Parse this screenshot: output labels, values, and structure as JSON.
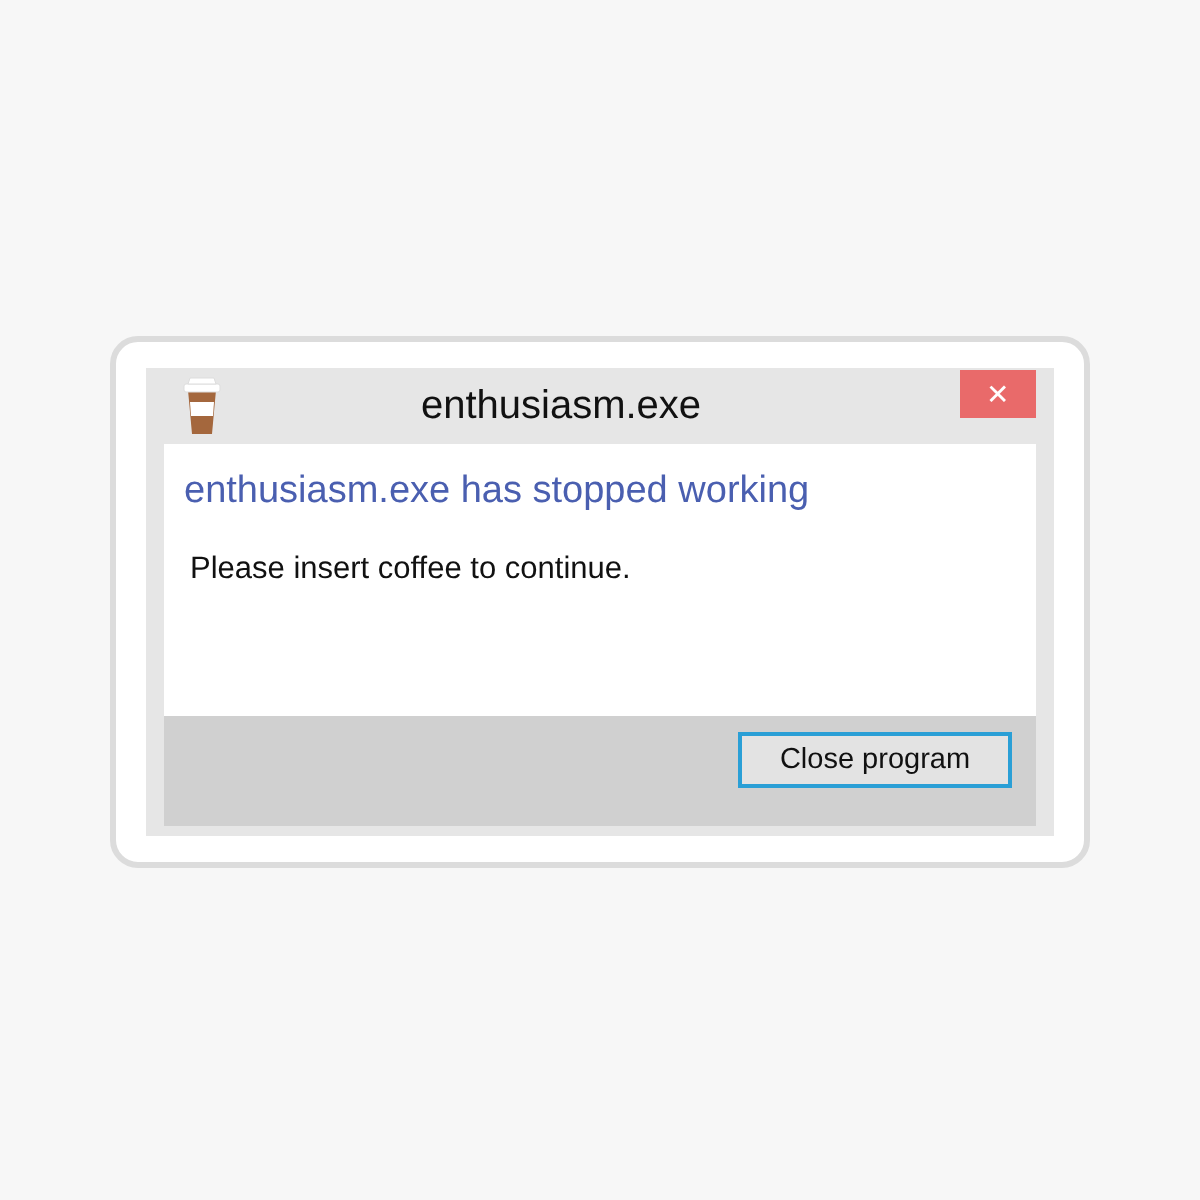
{
  "window": {
    "title": "enthusiasm.exe",
    "close": "✕"
  },
  "message": {
    "heading": "enthusiasm.exe has stopped working",
    "body": "Please insert coffee to continue."
  },
  "buttons": [
    {
      "label": "Close program",
      "selected": true
    }
  ]
}
